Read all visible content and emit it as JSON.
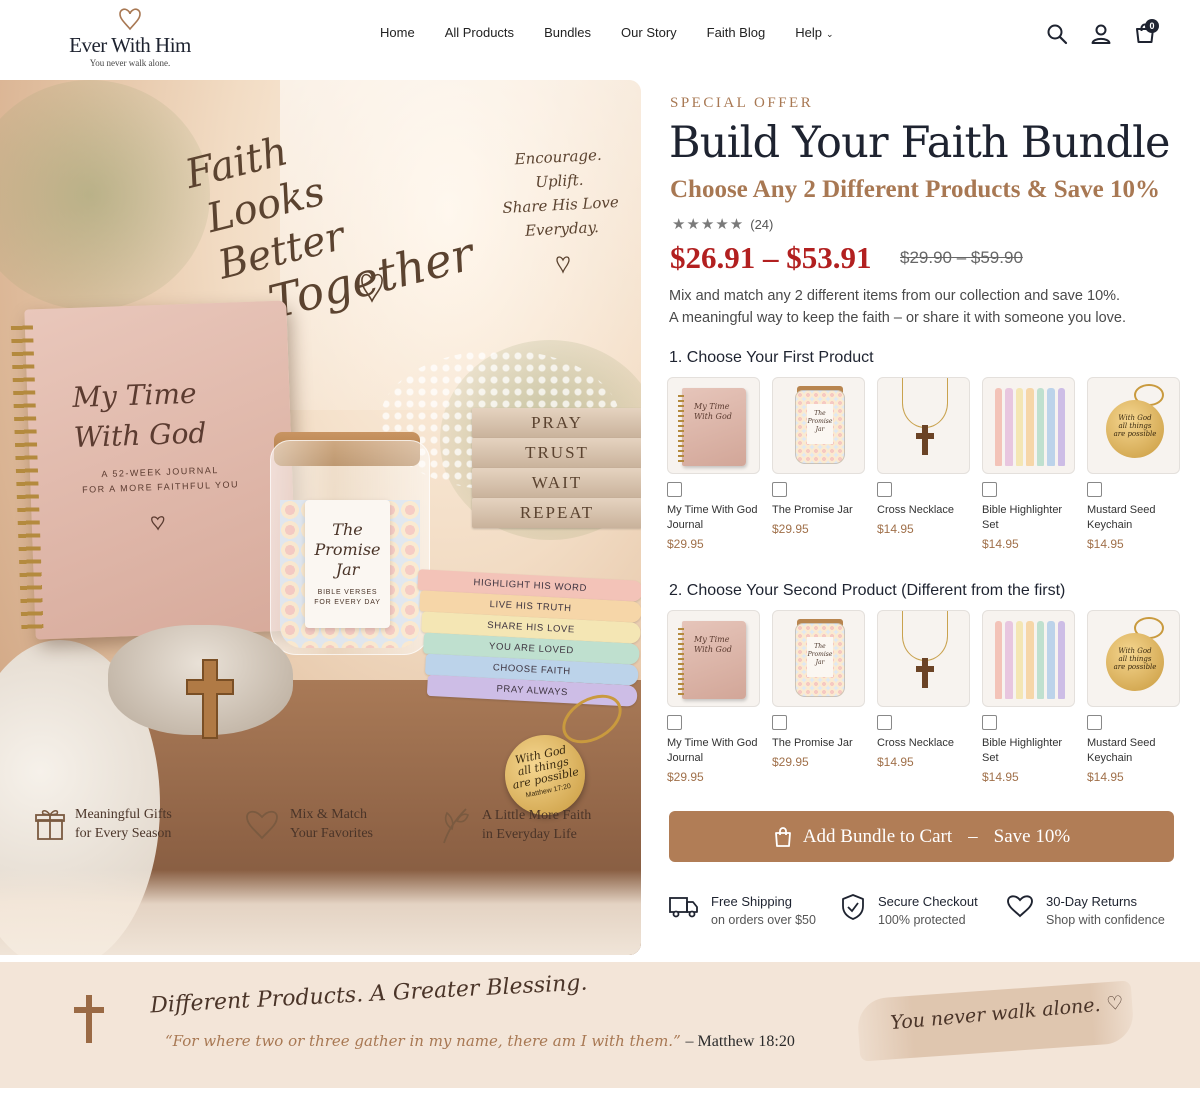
{
  "header": {
    "logo_name": "Ever With Him",
    "logo_tagline": "You never walk alone.",
    "nav": [
      "Home",
      "All Products",
      "Bundles",
      "Our Story",
      "Faith Blog",
      "Help"
    ],
    "cart_count": "0"
  },
  "hero": {
    "script_lines": [
      "Faith",
      "Looks Better",
      "Together"
    ],
    "side_lines": [
      "Encourage.",
      "Uplift.",
      "Share His Love",
      "Everyday."
    ],
    "journal_title": [
      "My Time",
      "With God"
    ],
    "journal_subtitle": [
      "A 52-WEEK JOURNAL",
      "FOR A MORE FAITHFUL YOU"
    ],
    "jar_tag_title": [
      "The",
      "Promise",
      "Jar"
    ],
    "jar_tag_subtitle": [
      "BIBLE VERSES",
      "FOR EVERY DAY"
    ],
    "book_stack": [
      "PRAY",
      "TRUST",
      "WAIT",
      "REPEAT"
    ],
    "markers": [
      {
        "label": "HIGHLIGHT HIS WORD",
        "color": "#f3c3b8"
      },
      {
        "label": "LIVE HIS TRUTH",
        "color": "#f6d6a8"
      },
      {
        "label": "SHARE HIS LOVE",
        "color": "#f4e6b4"
      },
      {
        "label": "YOU ARE LOVED",
        "color": "#bfe0cf"
      },
      {
        "label": "CHOOSE FAITH",
        "color": "#bcd3ea"
      },
      {
        "label": "PRAY ALWAYS",
        "color": "#cdbde6"
      }
    ],
    "keychain_text": [
      "With God",
      "all things",
      "are possible"
    ],
    "keychain_ref": "Matthew 17:20",
    "features": [
      {
        "icon": "gift-icon",
        "lines": [
          "Meaningful Gifts",
          "for Every Season"
        ]
      },
      {
        "icon": "heart-icon",
        "lines": [
          "Mix & Match",
          "Your Favorites"
        ]
      },
      {
        "icon": "leaf-icon",
        "lines": [
          "A Little More Faith",
          "in Everyday Life"
        ]
      }
    ]
  },
  "offer": {
    "eyebrow": "SPECIAL OFFER",
    "title": "Build Your Faith Bundle",
    "subtitle": "Choose Any 2 Different Products & Save 10%",
    "stars": "★★★★★",
    "review_count": "(24)",
    "price": "$26.91 – $53.91",
    "compare_price": "$29.90 – $59.90",
    "description": [
      "Mix and match any 2 different items from our collection and save 10%.",
      "A meaningful way to keep the faith – or share it with someone you love."
    ]
  },
  "step1": {
    "title": "1. Choose Your First Product",
    "products": [
      {
        "name": "My Time With God Journal",
        "price": "$29.95",
        "kind": "journal"
      },
      {
        "name": "The Promise Jar",
        "price": "$29.95",
        "kind": "jar"
      },
      {
        "name": "Cross Necklace",
        "price": "$14.95",
        "kind": "necklace"
      },
      {
        "name": "Bible Highlighter Set",
        "price": "$14.95",
        "kind": "markers"
      },
      {
        "name": "Mustard Seed Keychain",
        "price": "$14.95",
        "kind": "keychain"
      }
    ]
  },
  "step2": {
    "title": "2. Choose Your Second Product (Different from the first)",
    "products": [
      {
        "name": "My Time With God Journal",
        "price": "$29.95",
        "kind": "journal"
      },
      {
        "name": "The Promise Jar",
        "price": "$29.95",
        "kind": "jar"
      },
      {
        "name": "Cross Necklace",
        "price": "$14.95",
        "kind": "necklace"
      },
      {
        "name": "Bible Highlighter Set",
        "price": "$14.95",
        "kind": "markers"
      },
      {
        "name": "Mustard Seed Keychain",
        "price": "$14.95",
        "kind": "keychain"
      }
    ]
  },
  "thumbnails": {
    "journal": [
      "My Time",
      "With God"
    ],
    "jar": [
      "The",
      "Promise",
      "Jar"
    ],
    "keychain": [
      "With God",
      "all things",
      "are possible"
    ]
  },
  "cart_button": {
    "label": "Add Bundle to Cart",
    "separator": "–",
    "save": "Save 10%"
  },
  "trust": [
    {
      "icon": "truck-icon",
      "title": "Free Shipping",
      "sub": "on orders over $50"
    },
    {
      "icon": "shield-check-icon",
      "title": "Secure Checkout",
      "sub": "100% protected"
    },
    {
      "icon": "heart-outline-icon",
      "title": "30-Day Returns",
      "sub": "Shop with confidence"
    }
  ],
  "band": {
    "title": "Different Products. A Greater Blessing.",
    "quote": "“For where two or three gather in my name, there am I with them.”",
    "quote_ref": "– Matthew 18:20",
    "brush_text": "You never walk alone."
  },
  "colors": {
    "accent": "#b17d56",
    "brand_dark": "#1e2330",
    "price_red": "#b22020",
    "band_bg": "#f3e5d8"
  }
}
